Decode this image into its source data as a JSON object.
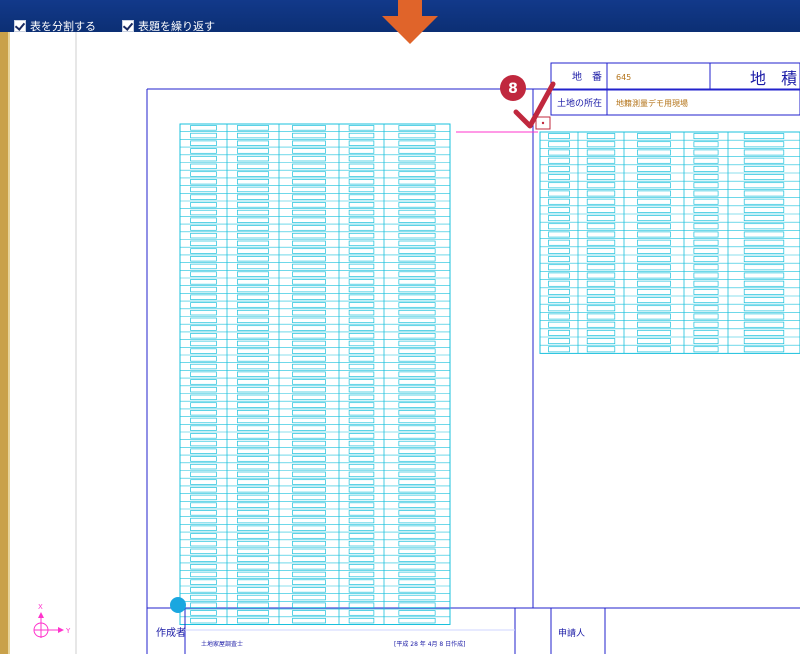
{
  "toolbar": {
    "split_table_label": "表を分割する",
    "repeat_header_label": "表題を繰り返す"
  },
  "step_badge": "8",
  "title_block": {
    "chiban_label": "地　番",
    "chiban_value": "645",
    "title": "地 積",
    "location_label": "土地の所在",
    "location_value": "地籍測量デモ用現場"
  },
  "footer": {
    "creator_label": "作成者",
    "creator_value": "土地家屋調査士",
    "date_text": "[平成 28 年 4月 8 日作成]",
    "applicant_label": "申請人"
  },
  "axis": {
    "x_label": "X",
    "y_label": "Y"
  },
  "colors": {
    "toolbar": "#0c2f74",
    "grid": "#19c0dc",
    "frame": "#2222cc",
    "accent": "#e0642a",
    "badge": "#c0283e"
  }
}
